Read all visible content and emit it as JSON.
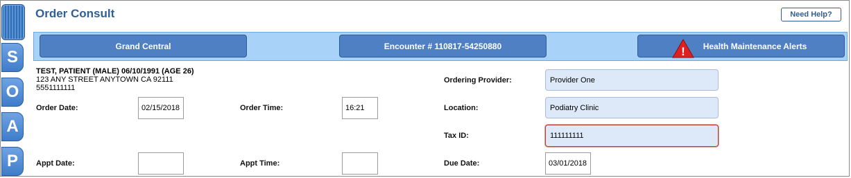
{
  "page": {
    "title": "Order Consult",
    "help_label": "Need Help?"
  },
  "soap_tabs": [
    "S",
    "O",
    "A",
    "P"
  ],
  "header_bar": {
    "grand_central": "Grand Central",
    "encounter": "Encounter # 110817-54250880",
    "health_alerts": "Health Maintenance Alerts",
    "warning_icon": "warning-triangle-icon",
    "warning_mark": "!"
  },
  "patient": {
    "name_line": "TEST, PATIENT (MALE) 06/10/1991 (AGE 26)",
    "address": "123 ANY STREET ANYTOWN CA 92111",
    "phone": "5551111111"
  },
  "form": {
    "order_date_label": "Order Date:",
    "order_date_value": "02/15/2018",
    "order_time_label": "Order Time:",
    "order_time_value": "16:21",
    "appt_date_label": "Appt Date:",
    "appt_date_value": "",
    "appt_time_label": "Appt Time:",
    "appt_time_value": "",
    "ordering_provider_label": "Ordering Provider:",
    "ordering_provider_value": "Provider One",
    "location_label": "Location:",
    "location_value": "Podiatry Clinic",
    "tax_id_label": "Tax ID:",
    "tax_id_value": "111111111",
    "due_date_label": "Due Date:",
    "due_date_value": "03/01/2018"
  },
  "colors": {
    "accent": "#2f5f96",
    "bar": "#a8d2f7",
    "button": "#4f80c4",
    "error_border": "#c0392b"
  }
}
